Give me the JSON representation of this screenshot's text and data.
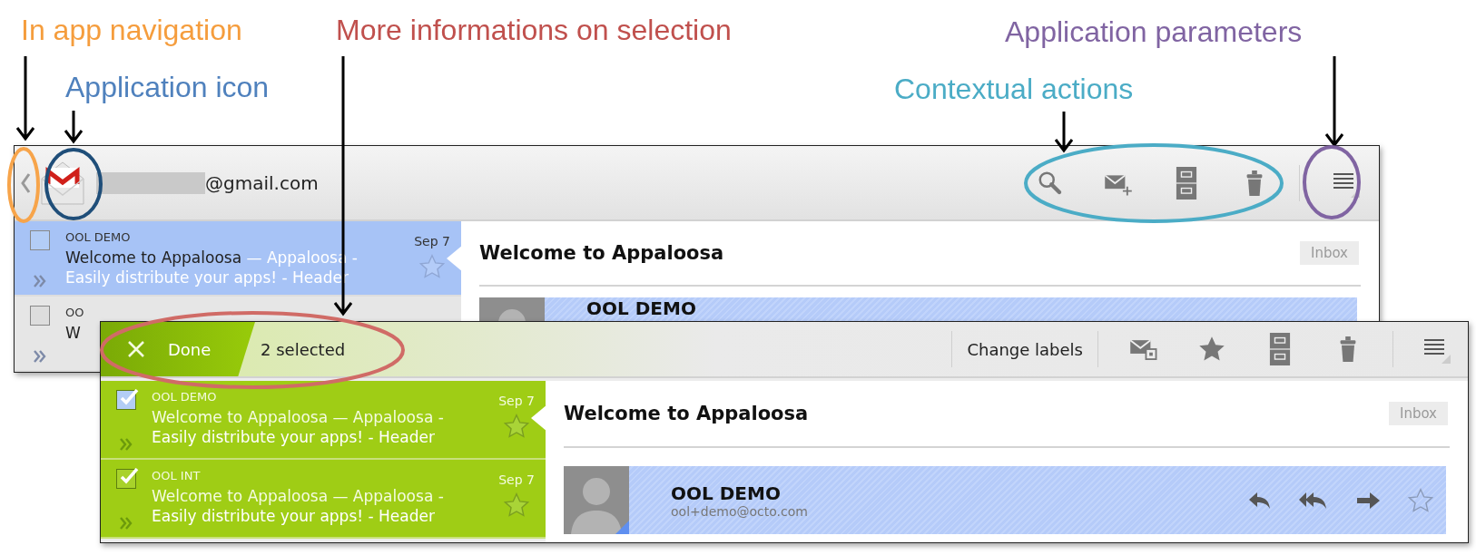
{
  "annotations": [
    {
      "text": "In app navigation",
      "color": "#f59d3d"
    },
    {
      "text": "More informations on selection",
      "color": "#c0504d"
    },
    {
      "text": "Application parameters",
      "color": "#8064a2"
    },
    {
      "text": "Application icon",
      "color": "#4f81bd"
    },
    {
      "text": "Contextual actions",
      "color": "#4bacc6"
    }
  ],
  "inbox_screen": {
    "account": "@gmail.com",
    "actions": [
      {
        "kind": "search"
      },
      {
        "kind": "compose"
      },
      {
        "kind": "archive"
      },
      {
        "kind": "trash"
      }
    ],
    "messages": [
      {
        "sender": "OOL DEMO",
        "subject": "Welcome to Appaloosa",
        "snippet": "— Appaloosa - Easily distribute your apps! - Header",
        "date": "Sep 7",
        "checked": false,
        "selected": true
      },
      {
        "sender": "OO",
        "subject": "W",
        "checked": false,
        "selected": false
      }
    ],
    "reading": {
      "title": "Welcome to Appaloosa",
      "label": "Inbox",
      "sender": "OOL DEMO"
    }
  },
  "selection_screen": {
    "done": "Done",
    "count": "2 selected",
    "actions": [
      {
        "kind": "text",
        "label": "Change labels"
      },
      {
        "kind": "label"
      },
      {
        "kind": "star"
      },
      {
        "kind": "archive"
      },
      {
        "kind": "trash"
      }
    ],
    "messages": [
      {
        "sender": "OOL DEMO",
        "subject": "Welcome to Appaloosa — Appaloosa -",
        "snippet": "Easily distribute your apps! - Header",
        "date": "Sep 7",
        "checked": true,
        "selected": true
      },
      {
        "sender": "OOL INT",
        "subject": "Welcome to Appaloosa — Appaloosa -",
        "snippet": "Easily distribute your apps! - Header",
        "date": "Sep 7",
        "checked": true,
        "selected": false
      }
    ],
    "reading": {
      "title": "Welcome to Appaloosa",
      "label": "Inbox",
      "sender": "OOL DEMO",
      "email": "ool+demo@octo.com"
    }
  }
}
